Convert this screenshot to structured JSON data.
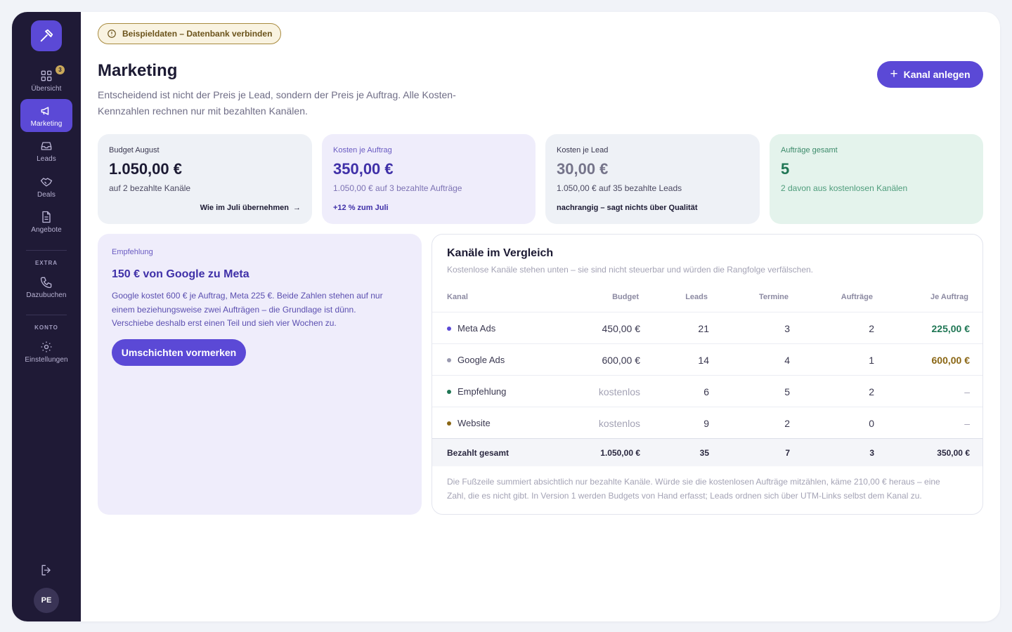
{
  "sidebar": {
    "items": [
      {
        "label": "Übersicht",
        "icon": "grid-icon",
        "badge": "3"
      },
      {
        "label": "Marketing",
        "icon": "megaphone-icon",
        "active": true
      },
      {
        "label": "Leads",
        "icon": "inbox-icon"
      },
      {
        "label": "Deals",
        "icon": "handshake-icon"
      },
      {
        "label": "Angebote",
        "icon": "document-icon"
      }
    ],
    "section_extra": "EXTRA",
    "extra_items": [
      {
        "label": "Dazubuchen",
        "icon": "phone-icon"
      }
    ],
    "section_konto": "KONTO",
    "konto_items": [
      {
        "label": "Einstellungen",
        "icon": "gear-icon"
      }
    ],
    "avatar_initials": "PE"
  },
  "notice": {
    "label": "Beispieldaten – Datenbank verbinden"
  },
  "header": {
    "title": "Marketing",
    "subtitle": "Entscheidend ist nicht der Preis je Lead, sondern der Preis je Auftrag. Alle Kosten-Kennzahlen rechnen nur mit bezahlten Kanälen.",
    "add_button": "Kanal anlegen"
  },
  "kpis": [
    {
      "label": "Budget August",
      "value": "1.050,00 €",
      "sub": "auf 2 bezahlte Kanäle",
      "foot": "Wie im Juli übernehmen"
    },
    {
      "label": "Kosten je Auftrag",
      "value": "350,00 €",
      "sub": "1.050,00 € auf 3 bezahlte Aufträge",
      "foot": "+12 % zum Juli"
    },
    {
      "label": "Kosten je Lead",
      "value": "30,00 €",
      "sub": "1.050,00 € auf 35 bezahlte Leads",
      "foot": "nachrangig – sagt nichts über Qualität"
    },
    {
      "label": "Aufträge gesamt",
      "value": "5",
      "sub": "2 davon aus kostenlosen Kanälen"
    }
  ],
  "recommendation": {
    "label": "Empfehlung",
    "title": "150 € von Google zu Meta",
    "body": "Google kostet 600 € je Auftrag, Meta 225 €. Beide Zahlen stehen auf nur einem beziehungsweise zwei Aufträgen – die Grundlage ist dünn. Verschiebe deshalb erst einen Teil und sieh vier Wochen zu.",
    "button": "Umschichten vormerken"
  },
  "table": {
    "title": "Kanäle im Vergleich",
    "subtitle": "Kostenlose Kanäle stehen unten – sie sind nicht steuerbar und würden die Rangfolge verfälschen.",
    "columns": [
      "Kanal",
      "Budget",
      "Leads",
      "Termine",
      "Aufträge",
      "Je Auftrag"
    ],
    "rows": [
      {
        "name": "Meta Ads",
        "dot_color": "#5b49d6",
        "budget": "450,00 €",
        "leads": "21",
        "termine": "3",
        "auftraege": "2",
        "je_auftrag": "225,00 €"
      },
      {
        "name": "Google Ads",
        "dot_color": "#9a9ab0",
        "budget": "600,00 €",
        "leads": "14",
        "termine": "4",
        "auftraege": "1",
        "je_auftrag": "600,00 €"
      },
      {
        "name": "Empfehlung",
        "dot_color": "#1f7654",
        "budget": "kostenlos",
        "leads": "6",
        "termine": "5",
        "auftraege": "2",
        "je_auftrag": "–"
      },
      {
        "name": "Website",
        "dot_color": "#8a6614",
        "budget": "kostenlos",
        "leads": "9",
        "termine": "2",
        "auftraege": "0",
        "je_auftrag": "–"
      }
    ],
    "total": {
      "name": "Bezahlt gesamt",
      "budget": "1.050,00 €",
      "leads": "35",
      "termine": "7",
      "auftraege": "3",
      "je_auftrag": "350,00 €"
    },
    "footnote": "Die Fußzeile summiert absichtlich nur bezahlte Kanäle. Würde sie die kostenlosen Aufträge mitzählen, käme 210,00 € heraus – eine Zahl, die es nicht gibt. In Version 1 werden Budgets von Hand erfasst; Leads ordnen sich über UTM-Links selbst dem Kanal zu."
  },
  "colors": {
    "accent": "#5b49d6",
    "sidebar": "#1f1a36",
    "positive": "#1f7654",
    "warning": "#8a6614"
  }
}
